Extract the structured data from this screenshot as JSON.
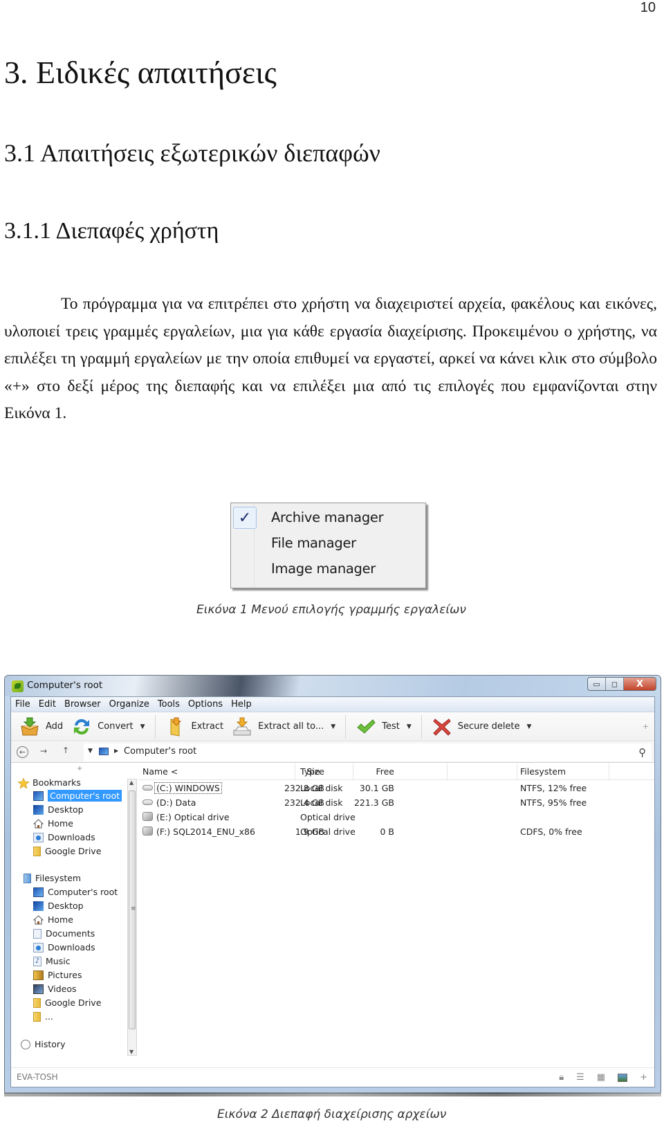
{
  "page_number": "10",
  "headings": {
    "h1": "3. Ειδικές απαιτήσεις",
    "h2": "3.1 Απαιτήσεις εξωτερικών διεπαφών",
    "h3": "3.1.1 Διεπαφές χρήστη"
  },
  "paragraph": "Το πρόγραμμα για να επιτρέπει στο χρήστη να διαχειριστεί αρχεία, φακέλους και εικόνες, υλοποιεί τρεις γραμμές εργαλείων, μια για κάθε εργασία διαχείρισης. Προκειμένου ο χρήστης, να επιλέξει τη γραμμή εργαλείων με την οποία επιθυμεί να εργαστεί, αρκεί να κάνει κλικ στο σύμβολο «+» στο δεξί μέρος της διεπαφής και να επιλέξει μια από τις επιλογές που εμφανίζονται στην Εικόνα 1.",
  "figure1": {
    "menu_items": [
      {
        "label": "Archive manager",
        "checked": true
      },
      {
        "label": "File manager",
        "checked": false
      },
      {
        "label": "Image manager",
        "checked": false
      }
    ],
    "check_glyph": "✓",
    "caption": "Εικόνα 1 Μενού επιλογής γραμμής εργαλείων"
  },
  "figure2": {
    "caption": "Εικόνα 2 Διεπαφή διαχείρισης αρχείων",
    "window": {
      "title": "Computer's root",
      "controls": {
        "minimize": "▭",
        "maximize": "◻",
        "close": "X"
      },
      "menu": [
        "File",
        "Edit",
        "Browser",
        "Organize",
        "Tools",
        "Options",
        "Help"
      ],
      "toolbar": [
        {
          "label": "Add",
          "icon": "add-box-icon",
          "dropdown": false
        },
        {
          "label": "Convert",
          "icon": "convert-arrows-icon",
          "dropdown": true
        },
        {
          "label": "Extract",
          "icon": "extract-folder-icon",
          "dropdown": false
        },
        {
          "label": "Extract all to...",
          "icon": "extract-all-icon",
          "dropdown": true
        },
        {
          "label": "Test",
          "icon": "checkmark-icon",
          "dropdown": true
        },
        {
          "label": "Secure delete",
          "icon": "red-x-icon",
          "dropdown": true
        }
      ],
      "toolbar_plus": "+",
      "address": {
        "back": "←",
        "forward": "→",
        "up": "↑",
        "path": "Computer's root"
      },
      "sidebar": {
        "plus": "+",
        "bookmarks_header": "Bookmarks",
        "bookmarks": [
          "Computer's root",
          "Desktop",
          "Home",
          "Downloads",
          "Google Drive"
        ],
        "selected": "Computer's root",
        "filesystem_header": "Filesystem",
        "filesystem": [
          "Computer's root",
          "Desktop",
          "Home",
          "Documents",
          "Downloads",
          "Music",
          "Pictures",
          "Videos",
          "Google Drive",
          "..."
        ],
        "history": "History"
      },
      "columns": [
        "Name <",
        "Type",
        "Size",
        "Free",
        "Filesystem"
      ],
      "rows": [
        {
          "name": "(C:) WINDOWS",
          "type": "Local disk",
          "size": "232.8 GB",
          "free": "30.1 GB",
          "filesystem": "NTFS, 12% free",
          "icon": "hard-drive-icon"
        },
        {
          "name": "(D:) Data",
          "type": "Local disk",
          "size": "232.4 GB",
          "free": "221.3 GB",
          "filesystem": "NTFS, 95% free",
          "icon": "hard-drive-icon"
        },
        {
          "name": "(E:) Optical drive",
          "type": "Optical drive",
          "size": "",
          "free": "",
          "filesystem": "",
          "icon": "optical-drive-icon"
        },
        {
          "name": "(F:) SQL2014_ENU_x86",
          "type": "Optical drive",
          "size": "1.9 GB",
          "free": "0 B",
          "filesystem": "CDFS, 0% free",
          "icon": "optical-drive-icon"
        }
      ],
      "status": "EVA-TOSH",
      "status_plus": "+"
    }
  }
}
